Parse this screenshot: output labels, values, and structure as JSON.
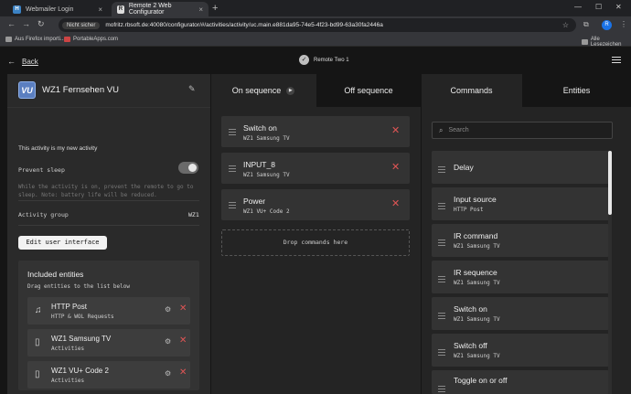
{
  "browser": {
    "tabs": [
      {
        "title": "Webmailer Login",
        "favicon": "H"
      },
      {
        "title": "Remote 2 Web Configurator",
        "favicon": "R"
      }
    ],
    "security_label": "Nicht sicher",
    "url": "mofritz.rbsoft.de:40080/configurator/#/activities/activity/uc.main.e881da95-74e5-4f23-bd99-63a30fa2446a",
    "profile_initial": "R",
    "bookmarks": [
      {
        "label": "Aus Firefox importi..."
      },
      {
        "label": "PortableApps.com"
      }
    ],
    "all_bookmarks_label": "Alle Lesezeichen"
  },
  "header": {
    "back_label": "Back",
    "remote_name": "Remote Two 1"
  },
  "activity": {
    "title": "WZ1 Fernsehen VU",
    "description": "This activity is my new activity",
    "prevent_sleep_label": "Prevent sleep",
    "prevent_sleep_note": "While the activity is on, prevent the remote to go to sleep. Note: battery life will be reduced.",
    "group_label": "Activity group",
    "group_value": "WZ1",
    "edit_ui_label": "Edit user interface"
  },
  "included": {
    "title": "Included entities",
    "subtitle": "Drag entities to the list below",
    "items": [
      {
        "name": "HTTP Post",
        "sub": "HTTP & WOL Requests",
        "icon": "music-note-icon"
      },
      {
        "name": "WZ1 Samsung TV",
        "sub": "Activities",
        "icon": "remote-icon"
      },
      {
        "name": "WZ1 VU+ Code 2",
        "sub": "Activities",
        "icon": "remote-icon"
      }
    ]
  },
  "sequence": {
    "tabs": [
      "On sequence",
      "Off sequence"
    ],
    "items": [
      {
        "name": "Switch on",
        "sub": "WZ1 Samsung TV"
      },
      {
        "name": "INPUT_8",
        "sub": "WZ1 Samsung TV"
      },
      {
        "name": "Power",
        "sub": "WZ1 VU+ Code 2"
      }
    ],
    "drop_label": "Drop commands here"
  },
  "commands": {
    "tabs": [
      "Commands",
      "Entities"
    ],
    "search_placeholder": "Search",
    "items": [
      {
        "name": "Delay",
        "sub": ""
      },
      {
        "name": "Input source",
        "sub": "HTTP Post"
      },
      {
        "name": "IR command",
        "sub": "WZ1 Samsung TV"
      },
      {
        "name": "IR sequence",
        "sub": "WZ1 Samsung TV"
      },
      {
        "name": "Switch on",
        "sub": "WZ1 Samsung TV"
      },
      {
        "name": "Switch off",
        "sub": "WZ1 Samsung TV"
      },
      {
        "name": "Toggle on or off",
        "sub": ""
      }
    ]
  },
  "colors": {
    "accent_delete": "#e05555",
    "logo_blue": "#5b7fc0"
  }
}
